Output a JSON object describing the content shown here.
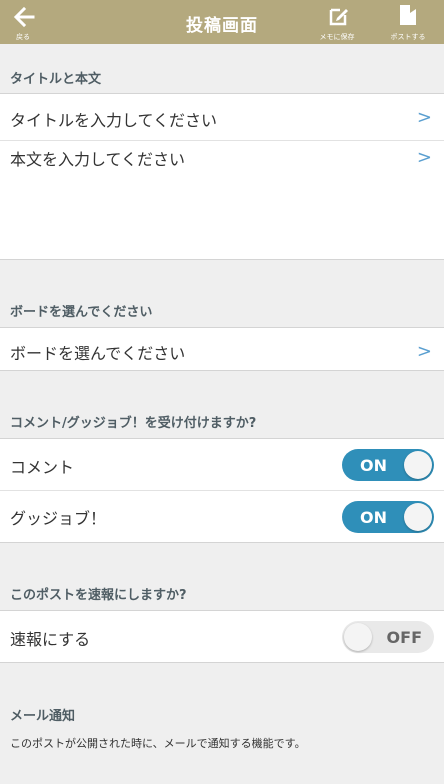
{
  "header": {
    "title": "投稿画面",
    "back_label": "戻る",
    "memo_label": "メモに保存",
    "post_label": "ポストする",
    "background_color": "#b4a97e"
  },
  "sections": {
    "title_body": {
      "heading": "タイトルと本文",
      "title_placeholder": "タイトルを入力してください",
      "body_placeholder": "本文を入力してください"
    },
    "board": {
      "heading": "ボードを選んでください",
      "select_label": "ボードを選んでください"
    },
    "comments": {
      "heading": "コメント/グッジョブ！を受け付けますか?",
      "comment_label": "コメント",
      "comment_state": "ON",
      "goodjob_label": "グッジョブ！",
      "goodjob_state": "ON"
    },
    "breaking": {
      "heading": "このポストを速報にしますか?",
      "label": "速報にする",
      "state": "OFF"
    },
    "mail": {
      "heading": "メール通知",
      "description": "このポストが公開された時に、メールで通知する機能です。"
    }
  },
  "icons": {
    "back": "arrow-left-icon",
    "memo": "edit-note-icon",
    "post": "bookmark-icon",
    "chevron": "chevron-right-icon"
  },
  "colors": {
    "accent": "#2f8fb9",
    "chevron": "#5a9fd0",
    "section_heading": "#4f5d64",
    "background": "#efefef"
  }
}
